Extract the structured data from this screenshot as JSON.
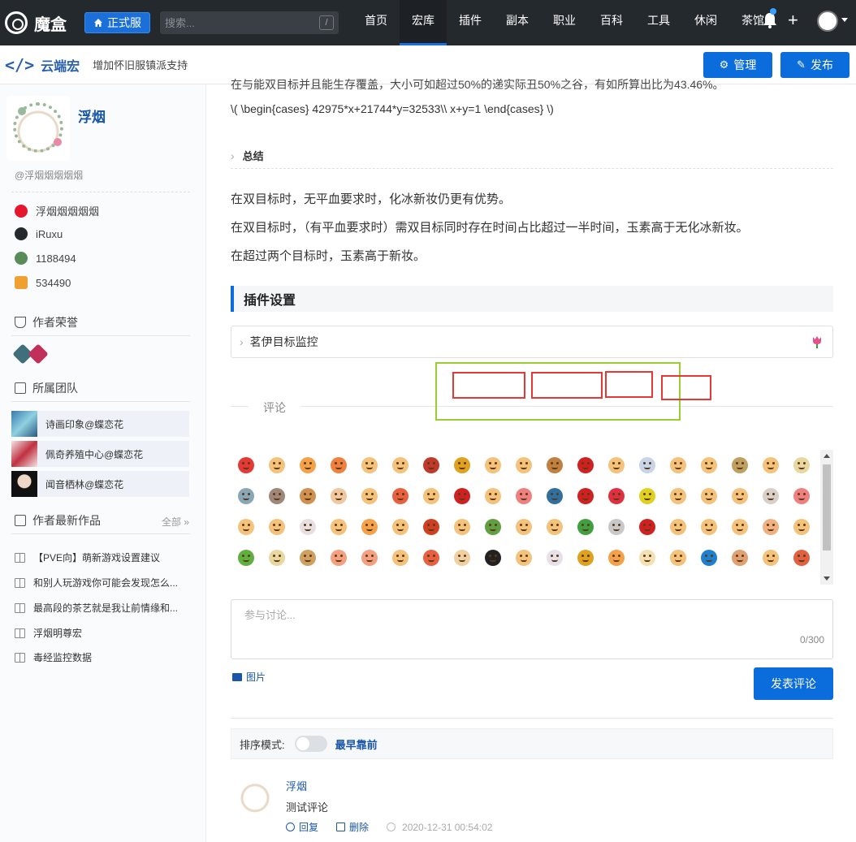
{
  "nav": {
    "logo_text": "魔盒",
    "server_label": "正式服",
    "search_placeholder": "搜索...",
    "search_key": "/",
    "links": [
      "首页",
      "宏库",
      "插件",
      "副本",
      "职业",
      "百科",
      "工具",
      "休闲",
      "茶馆"
    ],
    "active_link": "宏库",
    "plus": "+"
  },
  "subheader": {
    "title": "云端宏",
    "subtitle": "增加怀旧服镇派支持",
    "manage_label": "管理",
    "publish_label": "发布"
  },
  "sidebar": {
    "author_name": "浮烟",
    "author_handle": "@浮烟烟烟烟烟",
    "social": [
      {
        "icon": "weibo-icon",
        "text": "浮烟烟烟烟烟",
        "color": "#e6162d"
      },
      {
        "icon": "github-icon",
        "text": "iRuxu",
        "color": "#24292e"
      },
      {
        "icon": "game-a-icon",
        "text": "1188494",
        "color": "#5a8c5a"
      },
      {
        "icon": "game-b-icon",
        "text": "534490",
        "color": "#f0a030"
      }
    ],
    "honor_heading": "作者荣誉",
    "team_heading": "所属团队",
    "teams": [
      "诗画印象@蝶恋花",
      "佩奇养殖中心@蝶恋花",
      "闻音栖林@蝶恋花"
    ],
    "works_heading": "作者最新作品",
    "works_more": "全部 »",
    "works": [
      "【PVE向】萌新游戏设置建议",
      "和别人玩游戏你可能会发现怎么...",
      "最高段的茶艺就是我让前情缘和...",
      "浮烟明尊宏",
      "毒经监控数据"
    ]
  },
  "content": {
    "top_cutoff": "在与能双目标并且能生存覆盖，大小可如超过50%的递实际丑50%之谷，有如所算出比为43.46%。",
    "formula": "\\( \\begin{cases} 42975*x+21744*y=32533\\\\ x+y=1 \\end{cases} \\)",
    "summary_label": "总结",
    "paragraphs": [
      "在双目标时，无平血要求时，化冰新妆仍更有优势。",
      "在双目标时，（有平血要求时）需双目标同时存在时间占比超过一半时间，玉素高于无化冰新妆。",
      "在超过两个目标时，玉素高于新妆。"
    ],
    "plugin_heading": "插件设置",
    "plugin_item": "茗伊目标监控"
  },
  "comments": {
    "section_label": "评论",
    "input_placeholder": "参与讨论...",
    "char_count": "0/300",
    "image_label": "图片",
    "submit_label": "发表评论",
    "sort_label": "排序模式:",
    "sort_value": "最早靠前",
    "items": [
      {
        "author": "浮烟",
        "text": "测试评论",
        "reply": "回复",
        "delete": "删除",
        "time": "2020-12-31 00:54:02"
      }
    ]
  },
  "emoji_colors": [
    "#e53935",
    "#f4c27a",
    "#f4a14a",
    "#f08040",
    "#f4c27a",
    "#f4c27a",
    "#c0392b",
    "#e0a020",
    "#f4c27a",
    "#f4c27a",
    "#c08040",
    "#d02020",
    "#f4c27a",
    "#c8d4e8",
    "#f4c27a",
    "#f4c27a",
    "#c0a060",
    "#f4c27a",
    "#e8d8a0",
    "#88a8b8",
    "#a08878",
    "#d09050",
    "#f0c8a0",
    "#f4c27a",
    "#e86040",
    "#f4c27a",
    "#d02020",
    "#f4c27a",
    "#f08080",
    "#3070a0",
    "#d02020",
    "#e03040",
    "#e0d020",
    "#f4c27a",
    "#f4c27a",
    "#f4c27a",
    "#d8d0c8",
    "#f08080",
    "#f4c27a",
    "#f4c27a",
    "#e8e0e0",
    "#f4c27a",
    "#f4a14a",
    "#f4c27a",
    "#d04020",
    "#f4c27a",
    "#60a040",
    "#f4c27a",
    "#f4c27a",
    "#40a040",
    "#c8c8c8",
    "#d02020",
    "#f4c27a",
    "#f4c27a",
    "#f4c27a",
    "#f0b080",
    "#f4c27a",
    "#60b040",
    "#e8d8a0",
    "#d0a060",
    "#f4a080",
    "#f4a080",
    "#f4c27a",
    "#e86040",
    "#f0d0a0",
    "#222222",
    "#f4c27a",
    "#e8e0e8",
    "#e0a020",
    "#f4a14a",
    "#f4e0b0",
    "#f4c27a",
    "#2080d0",
    "#e0a070",
    "#f4c27a",
    "#e06040"
  ]
}
